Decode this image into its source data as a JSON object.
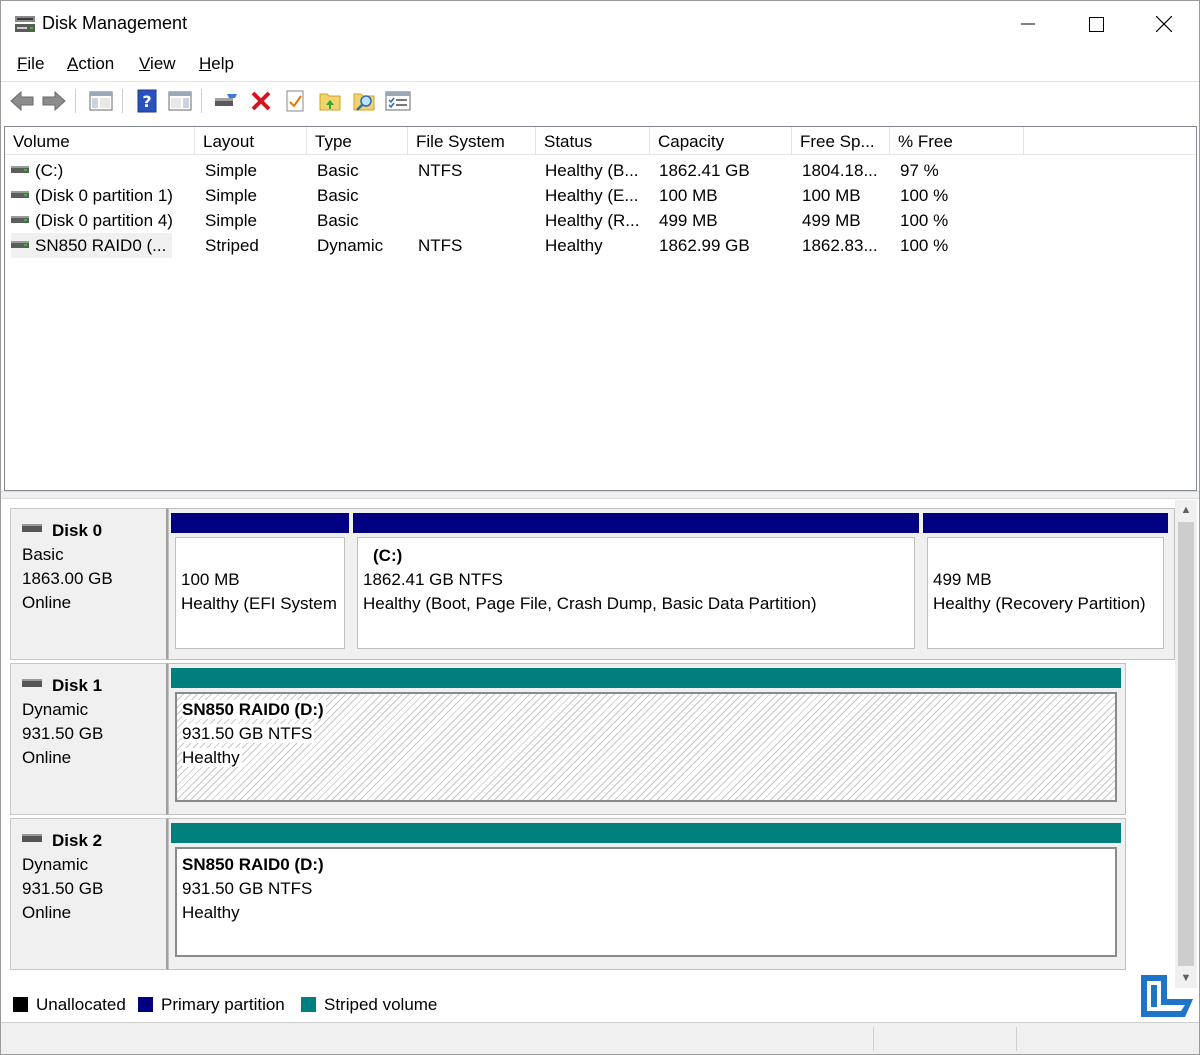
{
  "window": {
    "title": "Disk Management"
  },
  "menu": [
    "File",
    "Action",
    "View",
    "Help"
  ],
  "toolbar": {
    "buttons": [
      "back-icon",
      "forward-icon",
      "show-hide-console-tree-icon",
      "help-icon",
      "show-hide-action-pane-icon",
      "connect-disk-icon",
      "delete-icon",
      "properties-icon",
      "open-folder-icon",
      "explore-icon",
      "options-icon"
    ]
  },
  "volume_list": {
    "columns": [
      "Volume",
      "Layout",
      "Type",
      "File System",
      "Status",
      "Capacity",
      "Free Sp...",
      "% Free"
    ],
    "rows": [
      {
        "volume": "(C:)",
        "layout": "Simple",
        "type": "Basic",
        "fs": "NTFS",
        "status": "Healthy (B...",
        "capacity": "1862.41 GB",
        "free": "1804.18...",
        "pct": "97 %"
      },
      {
        "volume": "(Disk 0 partition 1)",
        "layout": "Simple",
        "type": "Basic",
        "fs": "",
        "status": "Healthy (E...",
        "capacity": "100 MB",
        "free": "100 MB",
        "pct": "100 %"
      },
      {
        "volume": "(Disk 0 partition 4)",
        "layout": "Simple",
        "type": "Basic",
        "fs": "",
        "status": "Healthy (R...",
        "capacity": "499 MB",
        "free": "499 MB",
        "pct": "100 %"
      },
      {
        "volume": "SN850 RAID0 (...",
        "layout": "Striped",
        "type": "Dynamic",
        "fs": "NTFS",
        "status": "Healthy",
        "capacity": "1862.99 GB",
        "free": "1862.83...",
        "pct": "100 %"
      }
    ]
  },
  "disks": [
    {
      "name": "Disk 0",
      "kind": "Basic",
      "size": "1863.00 GB",
      "state": "Online",
      "partitions": [
        {
          "name": "",
          "size": "100 MB",
          "status": "Healthy (EFI System"
        },
        {
          "name": "(C:)",
          "size": "1862.41 GB NTFS",
          "status": "Healthy (Boot, Page File, Crash Dump, Basic Data Partition)"
        },
        {
          "name": "",
          "size": "499 MB",
          "status": "Healthy (Recovery Partition)"
        }
      ]
    },
    {
      "name": "Disk 1",
      "kind": "Dynamic",
      "size": "931.50 GB",
      "state": "Online",
      "partitions": [
        {
          "name": "SN850 RAID0  (D:)",
          "size": "931.50 GB NTFS",
          "status": "Healthy"
        }
      ]
    },
    {
      "name": "Disk 2",
      "kind": "Dynamic",
      "size": "931.50 GB",
      "state": "Online",
      "partitions": [
        {
          "name": "SN850 RAID0  (D:)",
          "size": "931.50 GB NTFS",
          "status": "Healthy"
        }
      ]
    }
  ],
  "legend": [
    {
      "label": "Unallocated",
      "color": "#000000"
    },
    {
      "label": "Primary partition",
      "color": "#000080"
    },
    {
      "label": "Striped volume",
      "color": "#007f7f"
    }
  ],
  "colors": {
    "primary": "#000080",
    "striped": "#007f7f",
    "watermark": "#1e74c8"
  }
}
